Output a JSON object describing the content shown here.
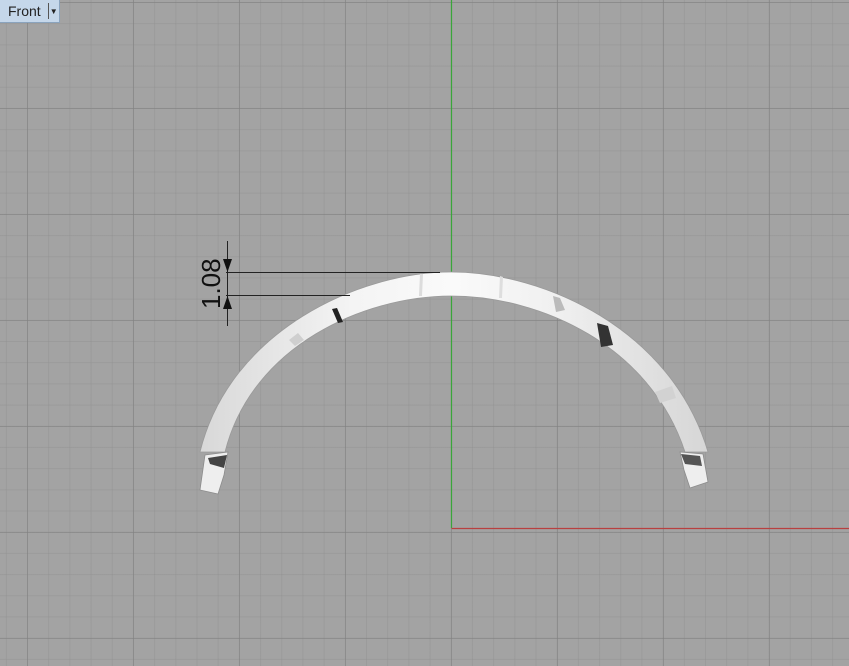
{
  "viewport": {
    "name": "Front",
    "menu_icon": "chevron-down-icon"
  },
  "dimension": {
    "value": "1.08"
  },
  "colors": {
    "background": "#a3a3a3",
    "grid_major": "#8a8a8a",
    "y_axis": "#3aa63a",
    "x_axis": "#b84040",
    "part": "#ececec"
  }
}
